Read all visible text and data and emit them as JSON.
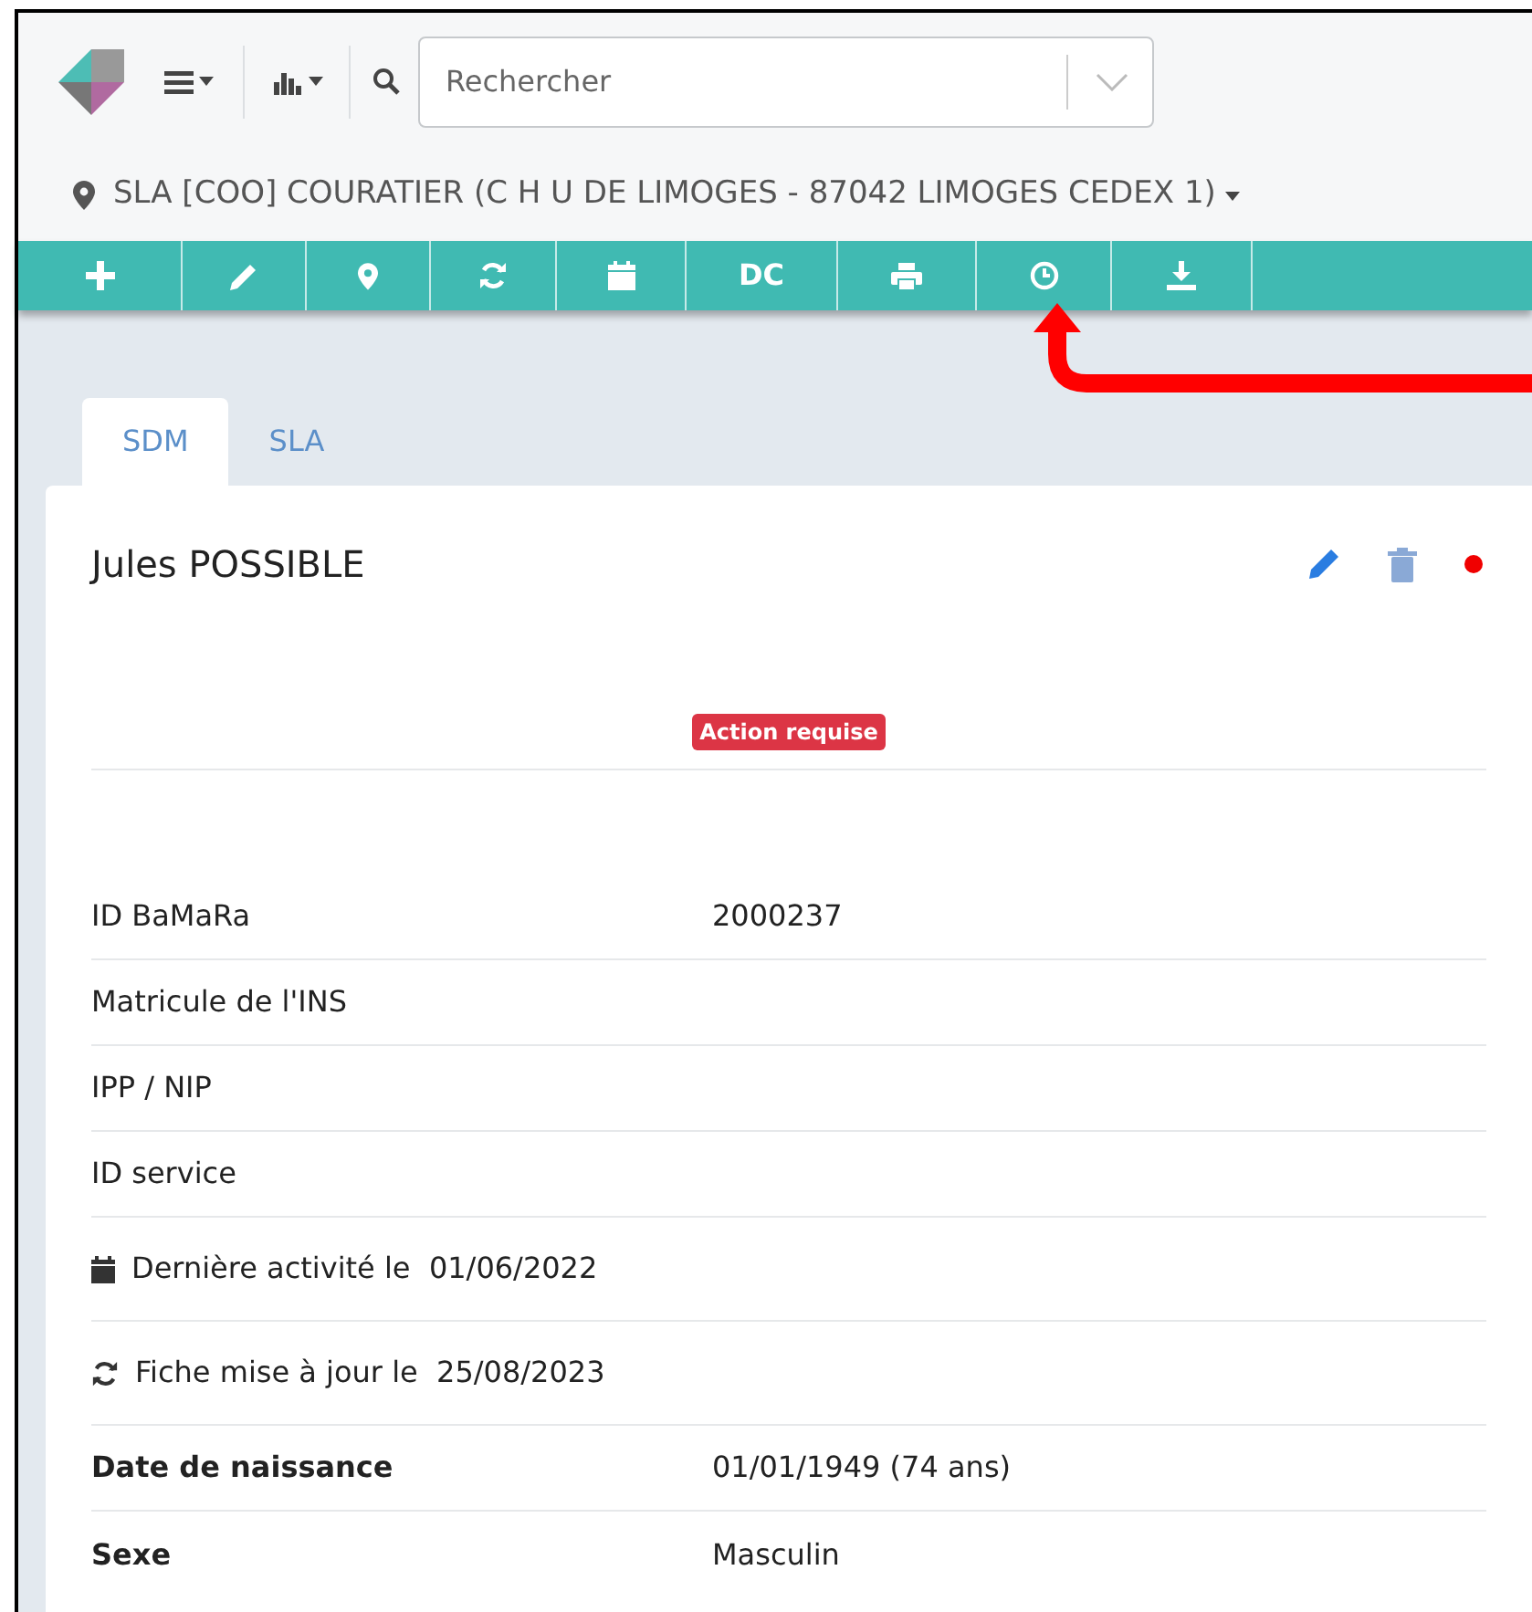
{
  "header": {
    "search": {
      "placeholder": "Rechercher"
    },
    "location": "SLA [COO] COURATIER (C H U DE LIMOGES - 87042 LIMOGES CEDEX 1)"
  },
  "toolbar": [
    {
      "kind": "plus"
    },
    {
      "kind": "pencil"
    },
    {
      "kind": "marker"
    },
    {
      "kind": "refresh"
    },
    {
      "kind": "calendar"
    },
    {
      "kind": "text",
      "label": "DC"
    },
    {
      "kind": "print"
    },
    {
      "kind": "clock"
    },
    {
      "kind": "download"
    }
  ],
  "tabs": [
    {
      "label": "SDM",
      "selected": true
    },
    {
      "label": "SLA",
      "selected": false
    }
  ],
  "patient": {
    "name": "Jules POSSIBLE",
    "badge": "Action requise"
  },
  "fields": [
    {
      "kind": "pair",
      "label": "ID BaMaRa",
      "value": "2000237",
      "bold": false
    },
    {
      "kind": "pair",
      "label": "Matricule de l'INS",
      "bold": false
    },
    {
      "kind": "pair",
      "label": "IPP / NIP",
      "bold": false
    },
    {
      "kind": "pair",
      "label": "ID service",
      "bold": false
    },
    {
      "kind": "calendar",
      "label": "Dernière activité le  01/06/2022"
    },
    {
      "kind": "refresh",
      "label": "Fiche mise à jour le  25/08/2023"
    },
    {
      "kind": "pair",
      "label": "Date de naissance",
      "value": "01/01/1949 (74 ans)",
      "bold": true
    },
    {
      "kind": "pair",
      "label": "Sexe",
      "value": "Masculin",
      "bold": true
    }
  ]
}
